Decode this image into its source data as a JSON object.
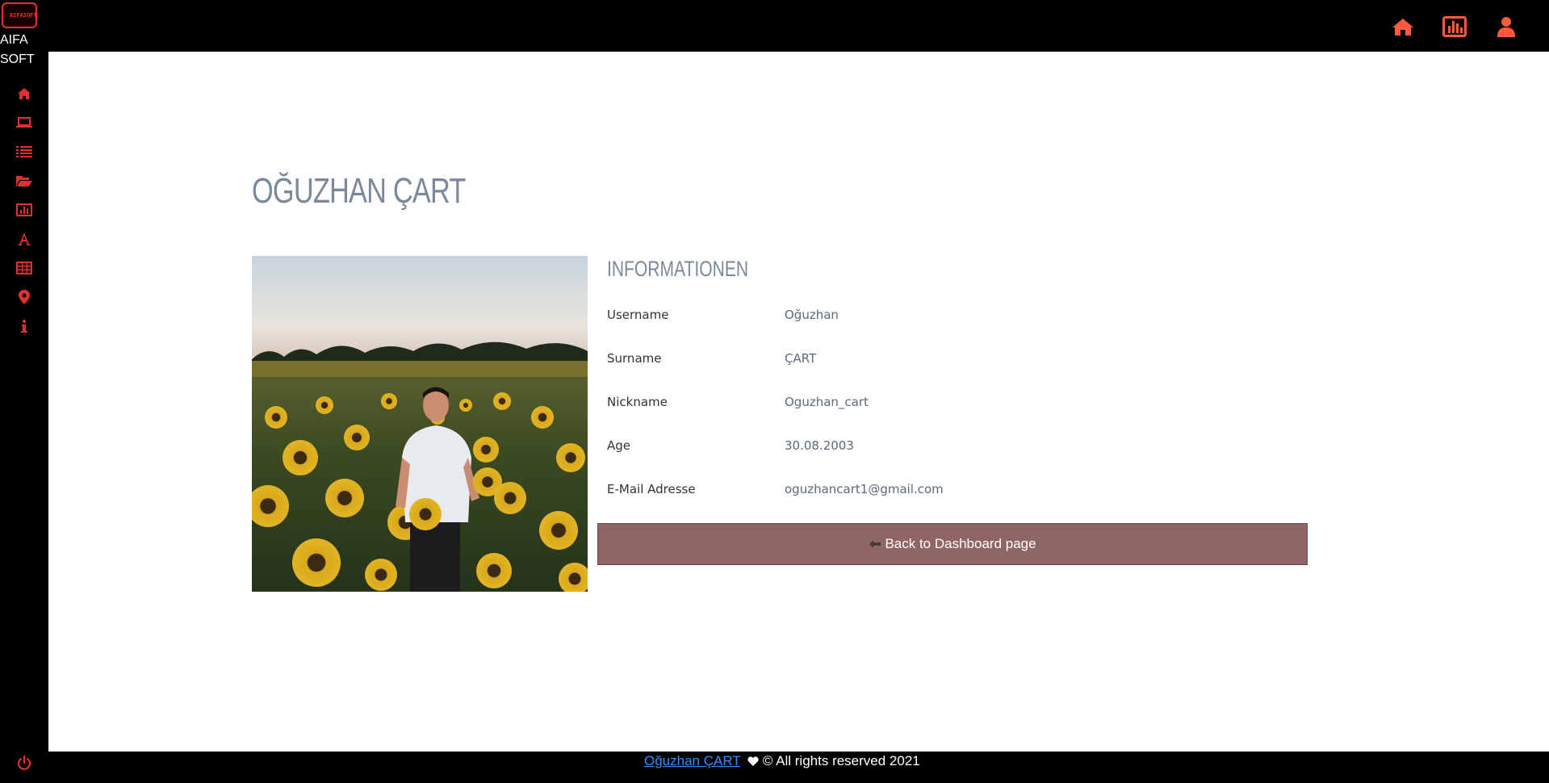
{
  "brand": {
    "logo_text": "AIFASOFT",
    "name_line1": "AIFA",
    "name_line2": "SOFT"
  },
  "colors": {
    "accent": "#e23030",
    "top_icon": "#ff5a3a",
    "button": "#8f6565",
    "title": "#7a8a9a"
  },
  "sidebar": {
    "items": [
      {
        "icon": "home-icon"
      },
      {
        "icon": "laptop-icon"
      },
      {
        "icon": "list-icon"
      },
      {
        "icon": "folder-open-icon"
      },
      {
        "icon": "bar-chart-icon"
      },
      {
        "icon": "font-icon"
      },
      {
        "icon": "table-icon"
      },
      {
        "icon": "map-marker-icon"
      },
      {
        "icon": "info-icon"
      }
    ],
    "bottom_icon": "power-icon"
  },
  "topbar": {
    "icons": [
      "home-icon",
      "bar-chart-icon",
      "user-icon"
    ]
  },
  "profile": {
    "title": "OĞUZHAN ÇART",
    "info_heading": "INFORMATIONEN",
    "rows": [
      {
        "label": "Username",
        "value": "Oğuzhan"
      },
      {
        "label": "Surname",
        "value": "ÇART"
      },
      {
        "label": "Nickname",
        "value": "Oguzhan_cart"
      },
      {
        "label": "Age",
        "value": "30.08.2003"
      },
      {
        "label": "E-Mail Adresse",
        "value": "oguzhancart1@gmail.com"
      }
    ],
    "back_button": "Back to Dashboard page"
  },
  "footer": {
    "link": "Oğuzhan ÇART",
    "rest": " © All rights reserved 2021"
  }
}
